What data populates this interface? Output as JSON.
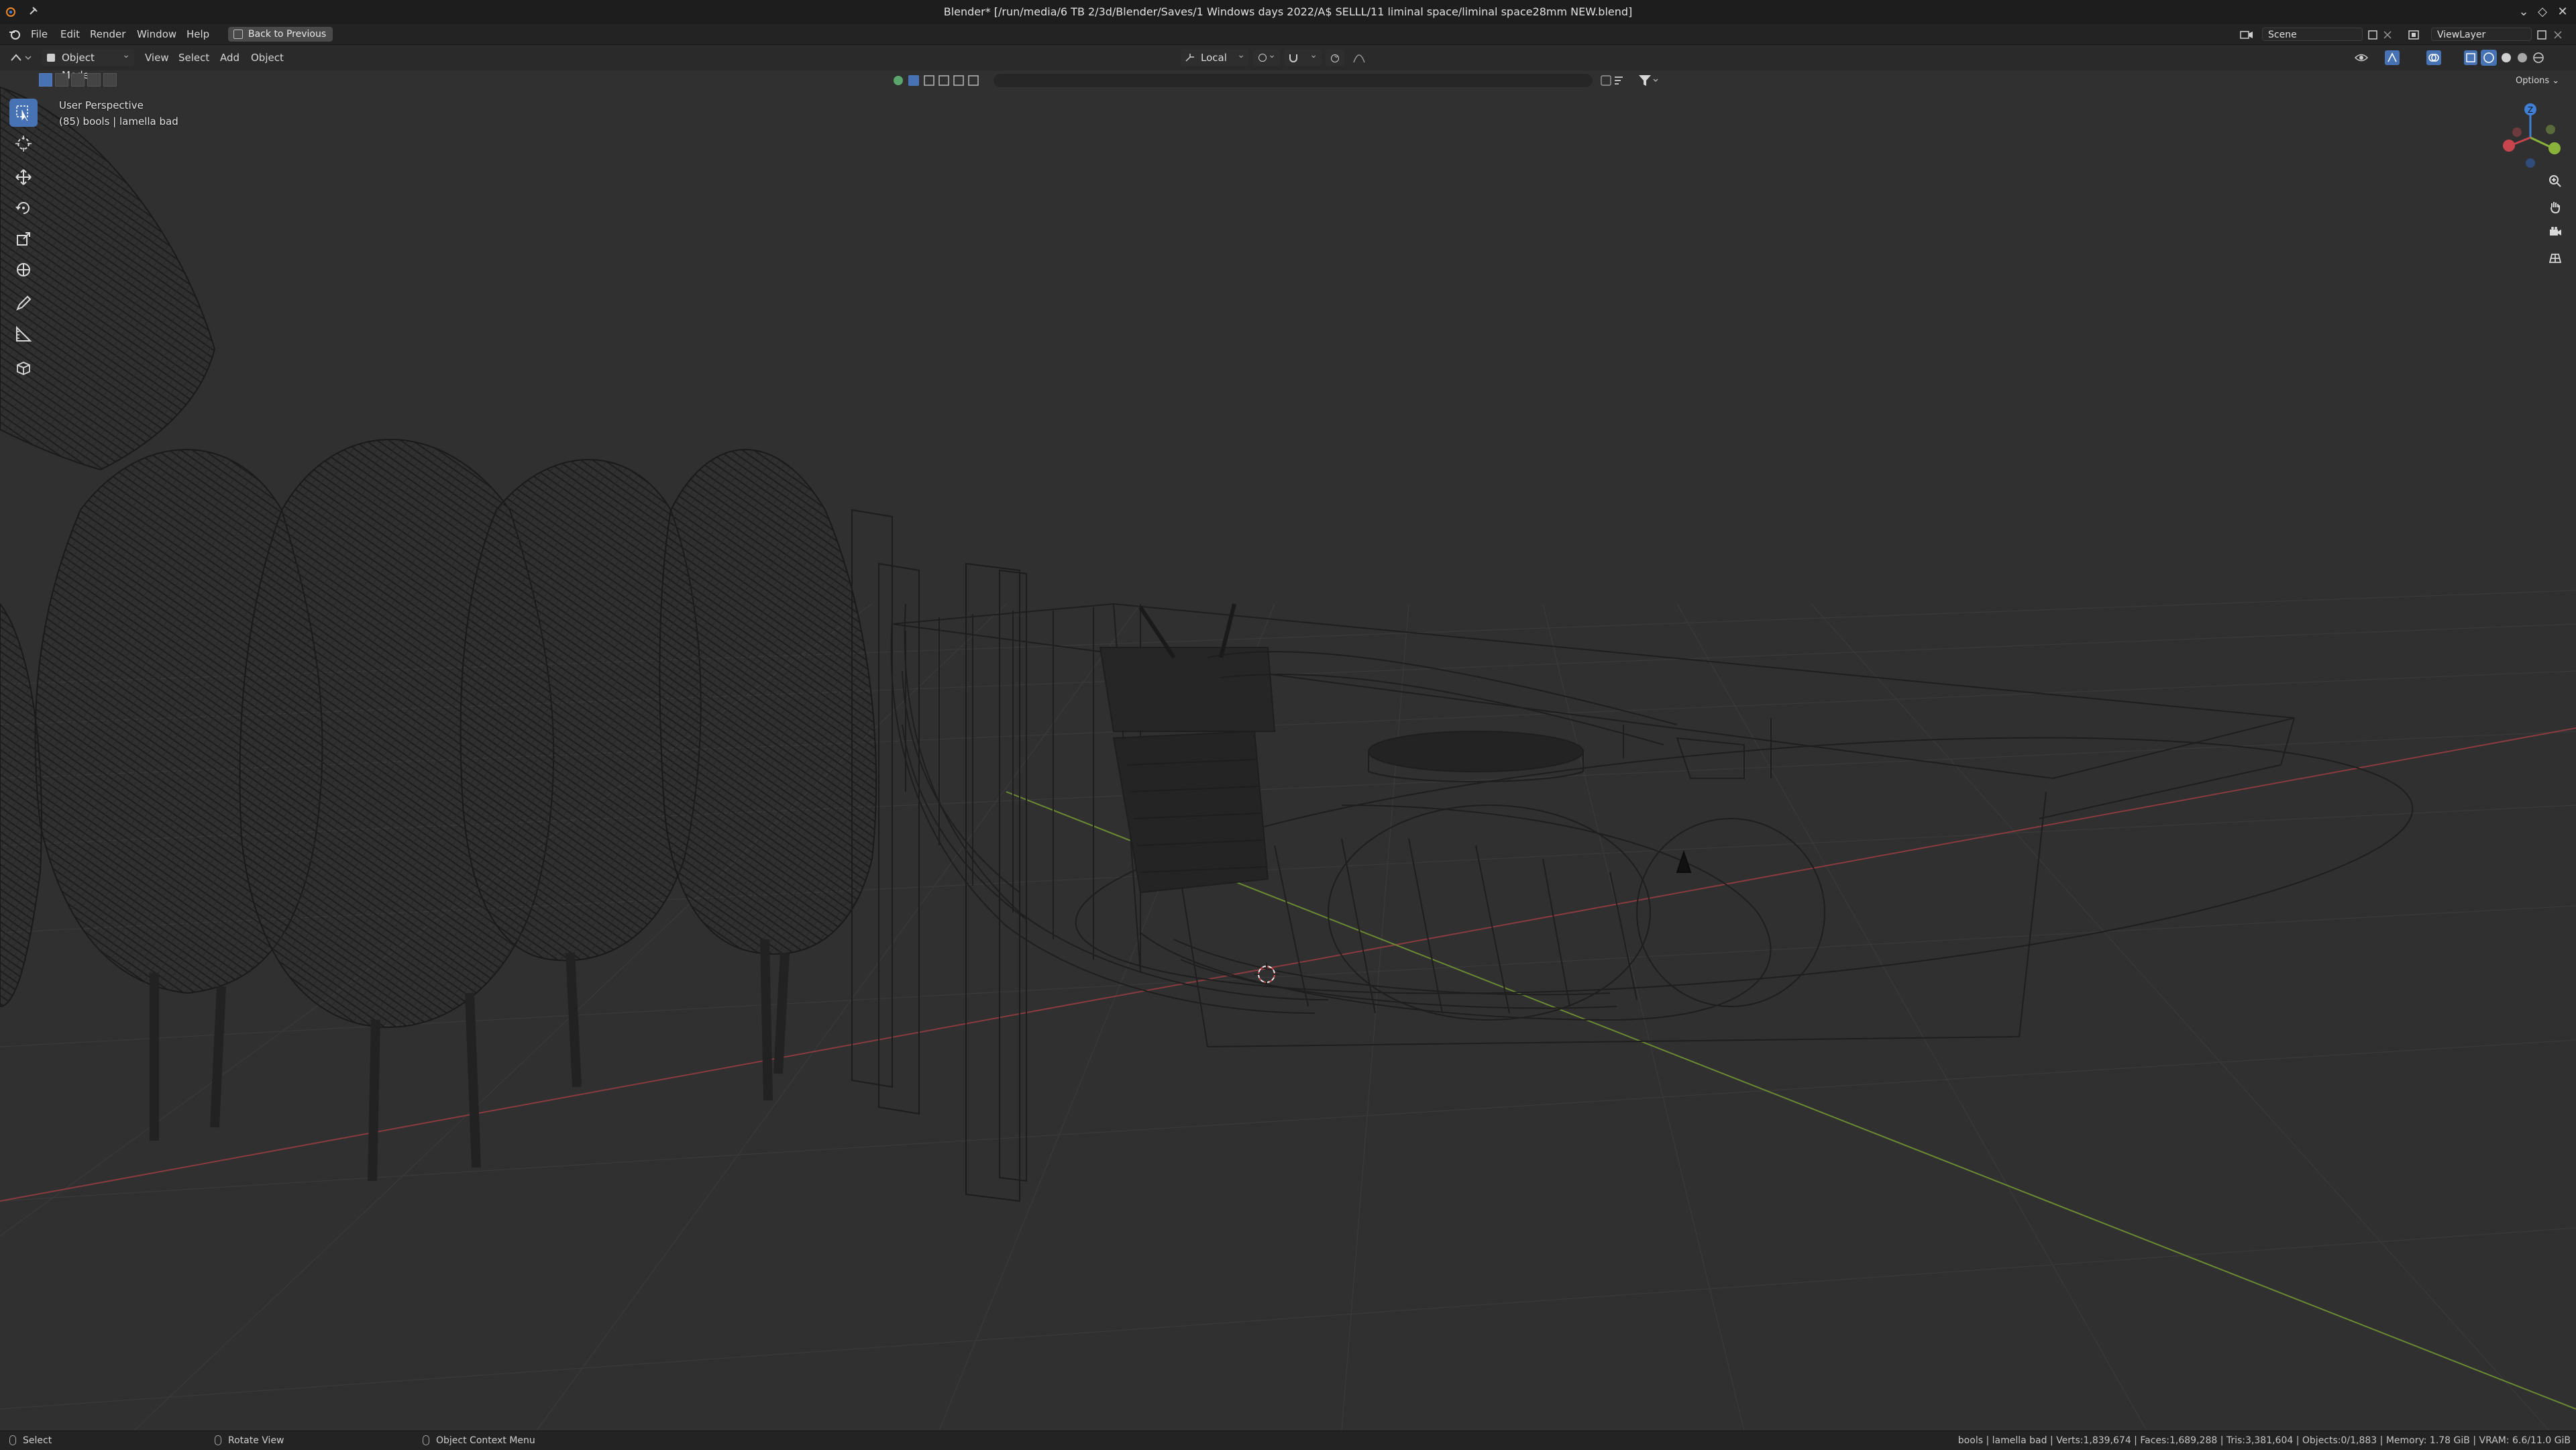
{
  "window": {
    "title": "Blender* [/run/media/6 TB 2/3d/Blender/Saves/1 Windows days 2022/A$ SELLL/11 liminal space/liminal space28mm NEW.blend]",
    "controls": [
      "⌄",
      "◇",
      "✕"
    ]
  },
  "menubar": {
    "items": [
      "File",
      "Edit",
      "Render",
      "Window",
      "Help"
    ],
    "back_button": "Back to Previous",
    "scene": "Scene",
    "view_layer": "ViewLayer"
  },
  "viewport_header": {
    "mode": "Object Mode",
    "menus": [
      "View",
      "Select",
      "Add",
      "Object"
    ],
    "transform_orientation": "Local",
    "options": "Options"
  },
  "viewport": {
    "perspective": "User Perspective",
    "object_info": "(85) bools | lamella bad",
    "gizmo_axes": {
      "x": "X",
      "y": "Y",
      "z": "Z"
    }
  },
  "tools": [
    "select-box",
    "cursor",
    "move",
    "rotate",
    "scale",
    "transform",
    "annotate",
    "measure",
    "add-cube"
  ],
  "statusbar": {
    "left": "Select",
    "middle": "Rotate View",
    "right": "Object Context Menu",
    "stats": "bools | lamella bad | Verts:1,839,674 | Faces:1,689,288 | Tris:3,381,604 | Objects:0/1,883 | Memory: 1.78 GiB | VRAM: 6.6/11.0 GiB"
  },
  "colors": {
    "accent": "#4772b3",
    "x_axis": "#c8454e",
    "y_axis": "#8ab33b",
    "z_axis": "#3f7fd6",
    "viewport_bg": "#303030"
  }
}
